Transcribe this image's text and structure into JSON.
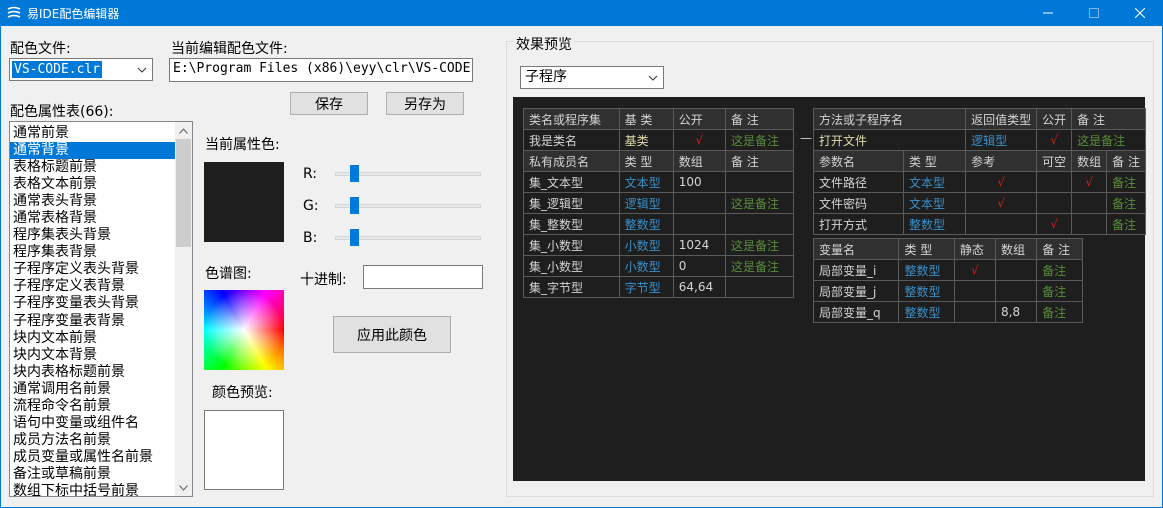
{
  "window": {
    "title": "易IDE配色编辑器",
    "icon": "app-logo-icon",
    "controls": [
      "minimize-icon",
      "maximize-icon",
      "close-icon"
    ]
  },
  "left": {
    "color_file_label": "配色文件:",
    "color_file_value": "VS-CODE.clr",
    "current_file_label": "当前编辑配色文件:",
    "current_file_path": "E:\\Program Files (x86)\\eyy\\clr\\VS-CODE",
    "save_button": "保存",
    "save_as_button": "另存为",
    "attr_table_label": "配色属性表(66):",
    "attr_items": [
      "通常前景",
      "通常背景",
      "表格标题前景",
      "表格文本前景",
      "通常表头背景",
      "通常表格背景",
      "程序集表头背景",
      "程序集表背景",
      "子程序定义表头背景",
      "子程序定义表背景",
      "子程序变量表头背景",
      "子程序变量表背景",
      "块内文本前景",
      "块内文本背景",
      "块内表格标题前景",
      "通常调用名前景",
      "流程命令名前景",
      "语句中变量或组件名",
      "成员方法名前景",
      "成员变量或属性名前景",
      "备注或草稿前景",
      "数组下标中括号前景"
    ],
    "selected_index": 1
  },
  "middle": {
    "current_color_label": "当前属性色:",
    "current_color": "#1e1e1e",
    "r_label": "R:",
    "g_label": "G:",
    "b_label": "B:",
    "r_value": 30,
    "g_value": 30,
    "b_value": 30,
    "spectrum_label": "色谱图:",
    "decimal_label": "十进制:",
    "decimal_value": "",
    "apply_button": "应用此颜色",
    "preview_label": "颜色预览:",
    "preview_color": "#ffffff"
  },
  "preview": {
    "group_label": "效果预览",
    "mode_value": "子程序",
    "class_table": {
      "header": [
        "类名或程序集",
        "基 类",
        "公开",
        "备 注"
      ],
      "row": [
        "我是类名",
        "基类",
        "√",
        "这是备注"
      ],
      "member_header": [
        "私有成员名",
        "类 型",
        "数组",
        "备 注"
      ],
      "members": [
        [
          "集_文本型",
          "文本型",
          "100",
          ""
        ],
        [
          "集_逻辑型",
          "逻辑型",
          "",
          "这是备注"
        ],
        [
          "集_整数型",
          "整数型",
          "",
          ""
        ],
        [
          "集_小数型",
          "小数型",
          "1024",
          "这是备注"
        ],
        [
          "集_小数型",
          "小数型",
          "0",
          "这是备注"
        ],
        [
          "集_字节型",
          "字节型",
          "64,64",
          ""
        ]
      ]
    },
    "method_table": {
      "header": [
        "方法或子程序名",
        "返回值类型",
        "公开",
        "备 注"
      ],
      "row": [
        "打开文件",
        "逻辑型",
        "√",
        "这是备注"
      ],
      "param_header": [
        "参数名",
        "类 型",
        "参考",
        "可空",
        "数组",
        "备 注"
      ],
      "params": [
        [
          "文件路径",
          "文本型",
          "√",
          "",
          "√",
          "备注"
        ],
        [
          "文件密码",
          "文本型",
          "√",
          "",
          "",
          "备注"
        ],
        [
          "打开方式",
          "整数型",
          "",
          "√",
          "",
          "备注"
        ]
      ]
    },
    "var_table": {
      "header": [
        "变量名",
        "类 型",
        "静态",
        "数组",
        "备 注"
      ],
      "rows": [
        [
          "局部变量_i",
          "整数型",
          "√",
          "",
          "备注"
        ],
        [
          "局部变量_j",
          "整数型",
          "",
          "",
          "备注"
        ],
        [
          "局部变量_q",
          "整数型",
          "",
          "8,8",
          "备注"
        ]
      ]
    },
    "connector": "—"
  }
}
